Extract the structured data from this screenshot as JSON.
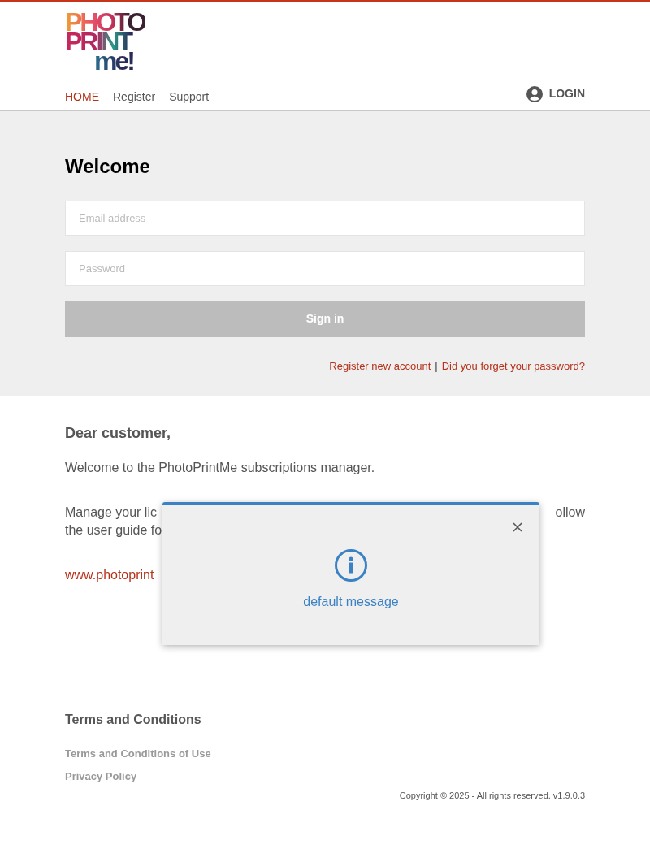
{
  "logo": {
    "lines": [
      "PHOTO",
      "PRINT",
      "me!"
    ]
  },
  "nav": {
    "items": [
      {
        "label": "HOME",
        "selected": true
      },
      {
        "label": "Register",
        "selected": false
      },
      {
        "label": "Support",
        "selected": false
      }
    ],
    "login": "LOGIN"
  },
  "login_form": {
    "title": "Welcome",
    "email": {
      "placeholder": "Email address"
    },
    "password": {
      "placeholder": "Password"
    },
    "submit": {
      "label": "Sign in",
      "disabled": true
    },
    "links": [
      "Register new account",
      "Did you forget your password?"
    ],
    "separator": "|"
  },
  "intro": {
    "heading": "Dear customer,",
    "text": "Welcome to the PhotoPrintMe subscriptions manager.",
    "paragraph_line_1_start": "Manage your lic",
    "paragraph_line_1_end": "ollow",
    "paragraph_line_2_start": "the user guide fo",
    "link": "www.photoprint"
  },
  "dialog": {
    "message": "default message"
  },
  "footer": {
    "heading": "Terms and Conditions",
    "links": [
      "Terms and Conditions of Use",
      "Privacy Policy"
    ],
    "copyright": "Copyright © 2025 - All rights reserved. v1.9.0.3"
  }
}
